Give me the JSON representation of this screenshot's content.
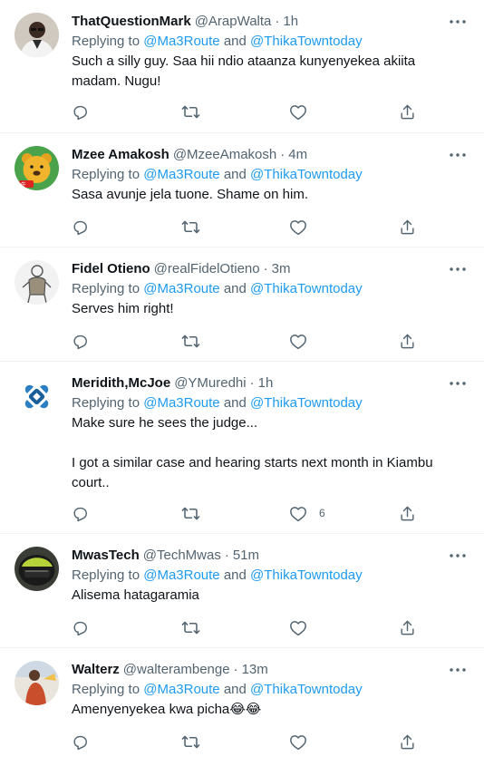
{
  "colors": {
    "link": "#1d9bf0",
    "muted": "#536471",
    "text": "#0f1419",
    "divider": "#eff3f4"
  },
  "tweets": [
    {
      "name": "ThatQuestionMark",
      "handle": "@ArapWalta",
      "sep": "·",
      "time": "1h",
      "reply_prefix": "Replying to ",
      "mention1": "@Ma3Route",
      "reply_and": " and ",
      "mention2": "@ThikaTowntoday",
      "text": "Such a silly guy. Saa hii ndio ataanza kunyenyekea akiita\nmadam. Nugu!",
      "avatar": "man-glasses-avatar"
    },
    {
      "name": "Mzee Amakosh",
      "handle": "@MzeeAmakosh",
      "sep": "·",
      "time": "4m",
      "reply_prefix": "Replying to ",
      "mention1": "@Ma3Route",
      "reply_and": " and ",
      "mention2": "@ThikaTowntoday",
      "text": "Sasa avunje jela tuone. Shame on him.",
      "avatar": "bear-avatar"
    },
    {
      "name": "Fidel Otieno",
      "handle": "@realFidelOtieno",
      "sep": "·",
      "time": "3m",
      "reply_prefix": "Replying to ",
      "mention1": "@Ma3Route",
      "reply_and": " and ",
      "mention2": "@ThikaTowntoday",
      "text": "Serves him right!",
      "avatar": "sketch-figure-avatar"
    },
    {
      "name": "Meridith,McJoe",
      "handle": "@YMuredhi",
      "sep": "·",
      "time": "1h",
      "reply_prefix": "Replying to ",
      "mention1": "@Ma3Route",
      "reply_and": " and ",
      "mention2": "@ThikaTowntoday",
      "text": "Make sure he sees the judge...\n\nI got a similar case and hearing starts next month in Kiambu\ncourt..",
      "like_count": "6",
      "avatar": "blue-knot-logo-avatar"
    },
    {
      "name": "MwasTech",
      "handle": "@TechMwas",
      "sep": "·",
      "time": "51m",
      "reply_prefix": "Replying to ",
      "mention1": "@Ma3Route",
      "reply_and": " and ",
      "mention2": "@ThikaTowntoday",
      "text": "Alisema hatagaramia",
      "avatar": "helmet-avatar"
    },
    {
      "name": "Walterz",
      "handle": "@walterambenge",
      "sep": "·",
      "time": "13m",
      "reply_prefix": "Replying to ",
      "mention1": "@Ma3Route",
      "reply_and": " and ",
      "mention2": "@ThikaTowntoday",
      "text": "Amenyenyekea kwa picha",
      "emoji": "😂😂",
      "avatar": "person-outdoor-avatar"
    }
  ]
}
